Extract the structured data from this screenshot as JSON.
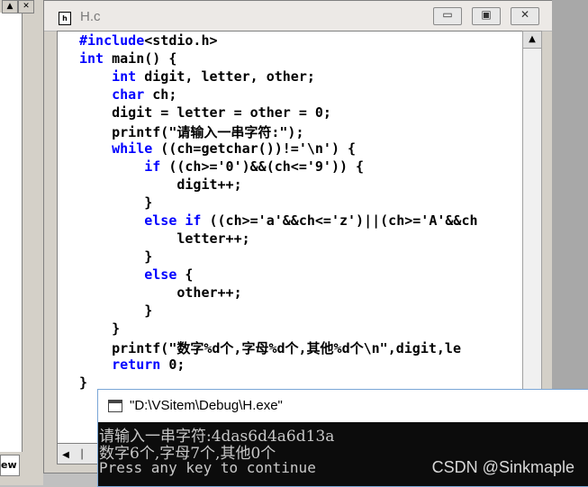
{
  "left_panel": {
    "btn_up": "▲",
    "btn_close": "✕",
    "tab_label": "ew"
  },
  "editor": {
    "title": "H.c",
    "doc_icon": "h",
    "min_icon": "minimize-icon",
    "max_icon": "maximize-icon",
    "close_icon": "close-icon",
    "min_glyph": "▭",
    "max_glyph": "▣",
    "close_glyph": "✕",
    "scroll_up_glyph": "▲",
    "hscroll_left": "◀",
    "hscroll_mark": "│",
    "code_lines": [
      "#include<stdio.h>",
      "int main() {",
      "    int digit, letter, other;",
      "    char ch;",
      "    digit = letter = other = 0;",
      "    printf(\"请输入一串字符:\");",
      "    while ((ch=getchar())!='\\n') {",
      "        if ((ch>='0')&&(ch<='9')) {",
      "            digit++;",
      "        }",
      "        else if ((ch>='a'&&ch<='z')||(ch>='A'&&ch",
      "            letter++;",
      "        }",
      "        else {",
      "            other++;",
      "        }",
      "    }",
      "    printf(\"数字%d个,字母%d个,其他%d个\\n\",digit,le",
      "    return 0;",
      "}"
    ]
  },
  "console": {
    "title": "\"D:\\VSitem\\Debug\\H.exe\"",
    "lines": [
      "请输入一串字符:4das6d4a6d13a",
      "数字6个,字母7个,其他0个",
      "Press any key to continue"
    ],
    "watermark": "CSDN @Sinkmaple"
  },
  "colors": {
    "keyword": "#0000ff",
    "console_bg": "#0c0c0c",
    "console_text": "#c8c8c8"
  }
}
